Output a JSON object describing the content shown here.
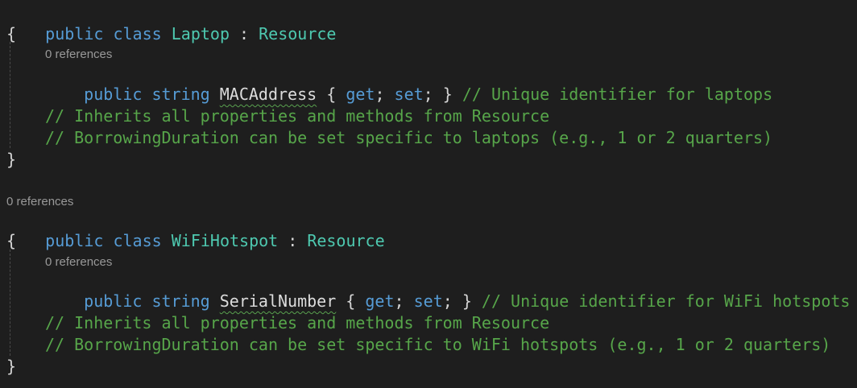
{
  "code_blocks": [
    {
      "class_decl": {
        "public": "public",
        "class": "class",
        "name": "Laptop",
        "colon": " : ",
        "base": "Resource"
      },
      "open_brace": "{",
      "member_refs": "0 references",
      "property": {
        "public": "public",
        "type": "string",
        "name": "MACAddress",
        "accessors_open": " { ",
        "get": "get",
        "semi1": "; ",
        "set": "set",
        "accessors_close": "; } ",
        "comment": "// Unique identifier for laptops"
      },
      "comment_1": "// Inherits all properties and methods from Resource",
      "comment_2": "// BorrowingDuration can be set specific to laptops (e.g., 1 or 2 quarters)",
      "close_brace": "}"
    },
    {
      "class_refs": "0 references",
      "class_decl": {
        "public": "public",
        "class": "class",
        "name": "WiFiHotspot",
        "colon": " : ",
        "base": "Resource"
      },
      "open_brace": "{",
      "member_refs": "0 references",
      "property": {
        "public": "public",
        "type": "string",
        "name": "SerialNumber",
        "accessors_open": " { ",
        "get": "get",
        "semi1": "; ",
        "set": "set",
        "accessors_close": "; } ",
        "comment": "// Unique identifier for WiFi hotspots"
      },
      "comment_1": "// Inherits all properties and methods from Resource",
      "comment_2": "// BorrowingDuration can be set specific to WiFi hotspots (e.g., 1 or 2 quarters)",
      "close_brace": "}"
    }
  ]
}
